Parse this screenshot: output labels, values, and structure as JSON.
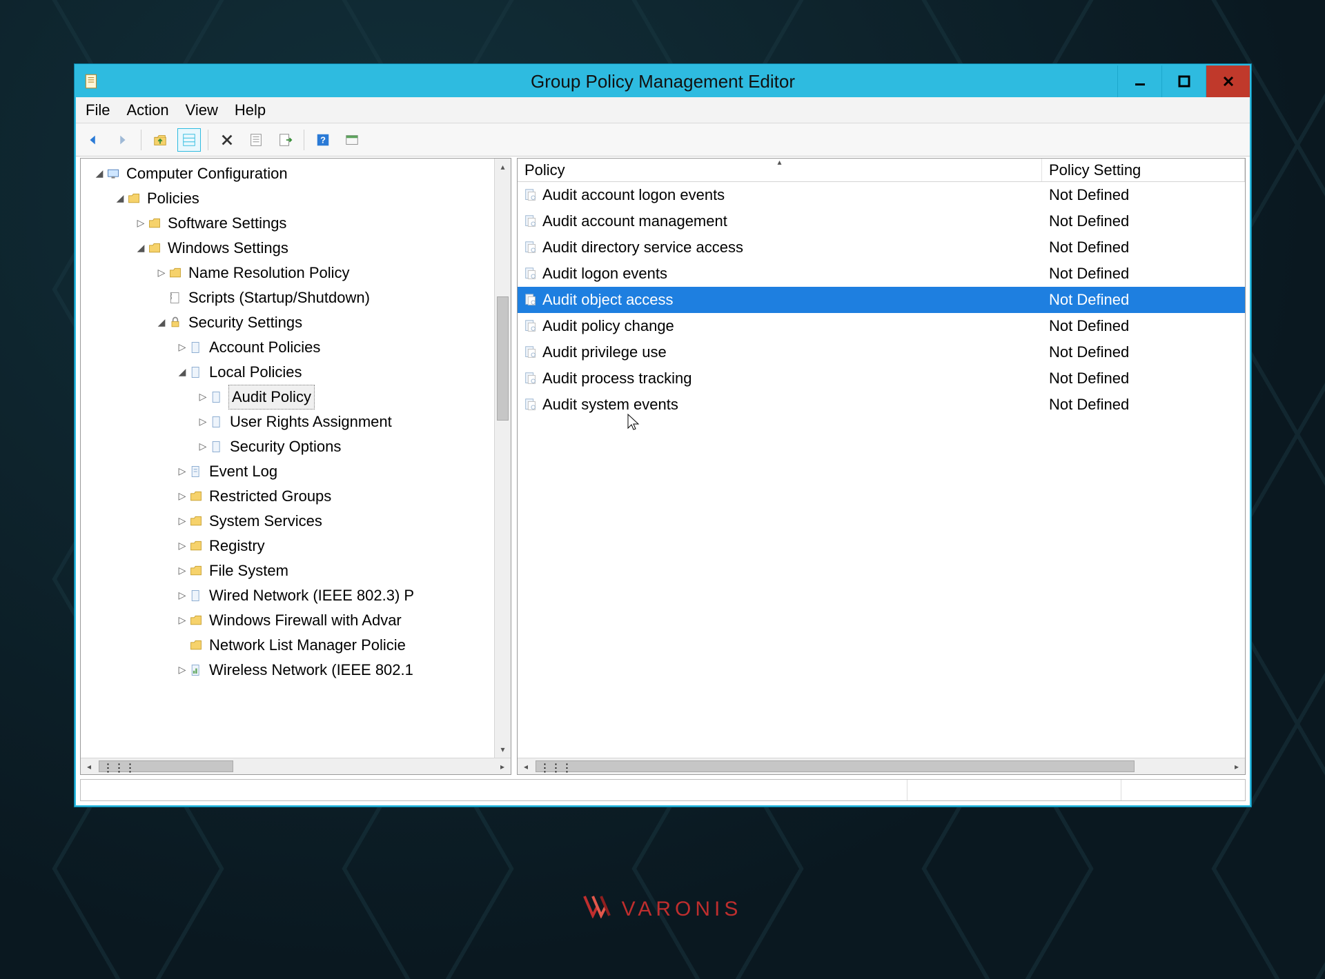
{
  "window": {
    "title": "Group Policy Management Editor"
  },
  "menubar": {
    "file": "File",
    "action": "Action",
    "view": "View",
    "help": "Help"
  },
  "tree": {
    "root": "Computer Configuration",
    "policies": "Policies",
    "software": "Software Settings",
    "windows": "Windows Settings",
    "nrp": "Name Resolution Policy",
    "scripts": "Scripts (Startup/Shutdown)",
    "security": "Security Settings",
    "account": "Account Policies",
    "local": "Local Policies",
    "audit": "Audit Policy",
    "ura": "User Rights Assignment",
    "secopt": "Security Options",
    "eventlog": "Event Log",
    "restricted": "Restricted Groups",
    "sysservices": "System Services",
    "registry": "Registry",
    "filesystem": "File System",
    "wired": "Wired Network (IEEE 802.3) P",
    "firewall": "Windows Firewall with Advar",
    "netlist": "Network List Manager Policie",
    "wireless": "Wireless Network (IEEE 802.1"
  },
  "columns": {
    "policy": "Policy",
    "setting": "Policy Setting"
  },
  "rows": [
    {
      "name": "Audit account logon events",
      "setting": "Not Defined",
      "selected": false
    },
    {
      "name": "Audit account management",
      "setting": "Not Defined",
      "selected": false
    },
    {
      "name": "Audit directory service access",
      "setting": "Not Defined",
      "selected": false
    },
    {
      "name": "Audit logon events",
      "setting": "Not Defined",
      "selected": false
    },
    {
      "name": "Audit object access",
      "setting": "Not Defined",
      "selected": true
    },
    {
      "name": "Audit policy change",
      "setting": "Not Defined",
      "selected": false
    },
    {
      "name": "Audit privilege use",
      "setting": "Not Defined",
      "selected": false
    },
    {
      "name": "Audit process tracking",
      "setting": "Not Defined",
      "selected": false
    },
    {
      "name": "Audit system events",
      "setting": "Not Defined",
      "selected": false
    }
  ],
  "brand": "VARONIS"
}
